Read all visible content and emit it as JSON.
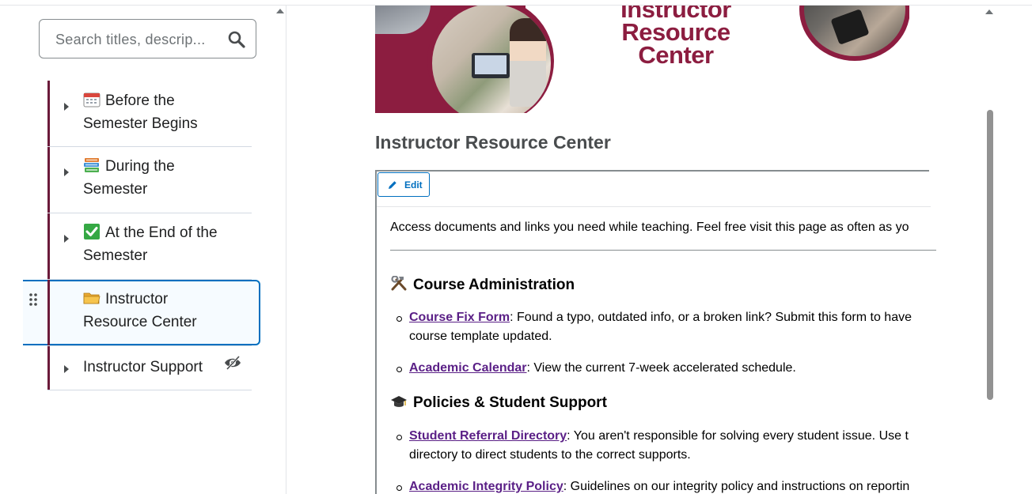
{
  "sidebar": {
    "search_placeholder": "Search titles, descrip...",
    "items": [
      {
        "label_line1": "Before the",
        "label_line2": "Semester Begins",
        "icon": "calendar-icon",
        "expandable": true
      },
      {
        "label_line1": "During the",
        "label_line2": "Semester",
        "icon": "books-icon",
        "expandable": true
      },
      {
        "label_line1": "At the End of the",
        "label_line2": "Semester",
        "icon": "check-mark-icon",
        "expandable": true
      },
      {
        "label_line1": "Instructor",
        "label_line2": "Resource Center",
        "icon": "folder-icon",
        "selected": true
      },
      {
        "label_line1": "Instructor Support",
        "expandable": true,
        "hidden": true
      }
    ]
  },
  "main": {
    "banner_title_line1": "Instructor",
    "banner_title_line2": "Resource",
    "banner_title_line3": "Center",
    "page_title": "Instructor Resource Center",
    "edit_label": "Edit",
    "intro": "Access documents and links you need while teaching. Feel free visit this page as often as yo",
    "sections": [
      {
        "heading": "Course Administration",
        "icon": "hammer-wrench-icon",
        "items": [
          {
            "link": "Course Fix Form",
            "text_line1": ": Found a typo, outdated info, or a broken link? Submit this form to have",
            "text_line2": "course template updated."
          },
          {
            "link": "Academic Calendar",
            "text_line1": ": View the current 7-week accelerated schedule."
          }
        ]
      },
      {
        "heading": "Policies & Student Support",
        "icon": "graduation-cap-icon",
        "items": [
          {
            "link": "Student Referral Directory",
            "text_line1": ": You aren't responsible for solving every student issue. Use t",
            "text_line2": "directory to direct students to the correct supports."
          },
          {
            "link": "Academic Integrity Policy",
            "text_line1": ": Guidelines on our integrity policy and instructions on reportin"
          }
        ]
      }
    ]
  },
  "colors": {
    "accent": "#006fbf",
    "brand": "#8c1d40",
    "link": "#5a1f86"
  }
}
